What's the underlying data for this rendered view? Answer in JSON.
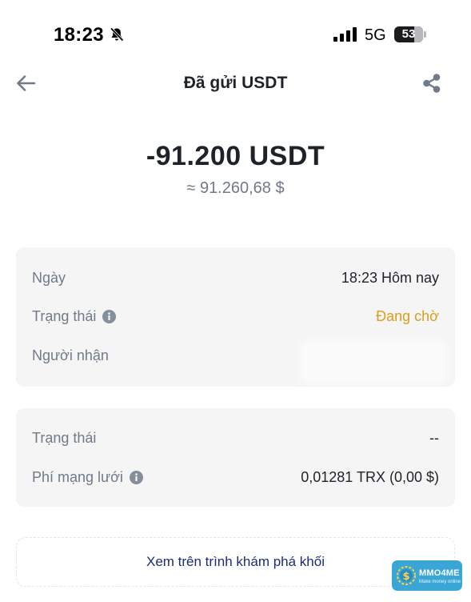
{
  "status_bar": {
    "time": "18:23",
    "network": "5G",
    "battery_percent": "53",
    "icons": [
      "bell-slash-icon",
      "signal-icon",
      "battery-icon"
    ]
  },
  "header": {
    "title": "Đã gửi USDT",
    "back_icon": "arrow-left-icon",
    "share_icon": "share-icon"
  },
  "transaction": {
    "amount": "-91.200 USDT",
    "fiat_value": "≈ 91.260,68 $"
  },
  "details_card": {
    "rows": [
      {
        "label": "Ngày",
        "value": "18:23 Hôm nay"
      },
      {
        "label": "Trạng thái",
        "value": "Đang chờ",
        "info_icon": true
      },
      {
        "label": "Người nhận",
        "value": ""
      }
    ]
  },
  "network_card": {
    "rows": [
      {
        "label": "Trạng thái",
        "value": "--"
      },
      {
        "label": "Phí mạng lưới",
        "value": "0,01281 TRX (0,00 $)",
        "info_icon": true
      }
    ]
  },
  "explorer_link": {
    "label": "Xem trên trình khám phá khối"
  },
  "watermark": {
    "brand": "MMO4ME",
    "tagline": "Make money online"
  },
  "colors": {
    "text_primary": "#1e2329",
    "text_secondary": "#707a8a",
    "pending": "#d89f1f",
    "card_bg": "#f5f5f5",
    "link": "#1c2c74"
  }
}
